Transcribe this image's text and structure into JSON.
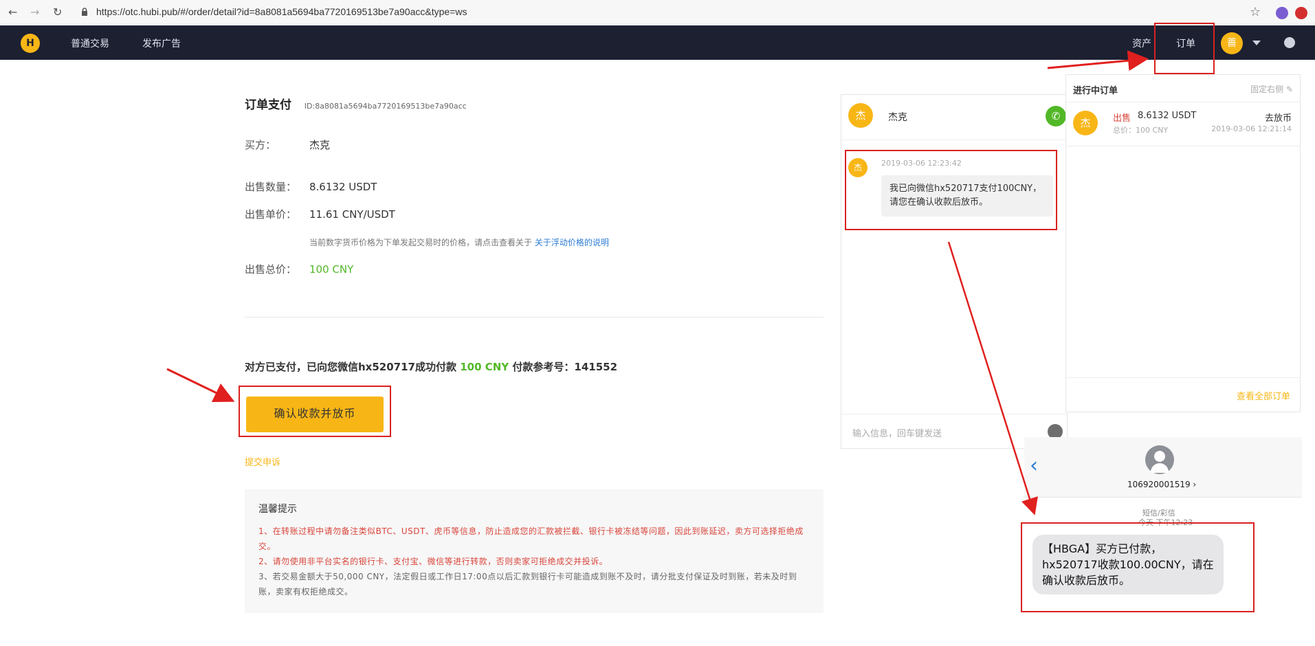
{
  "browser": {
    "url": "https://otc.hubi.pub/#/order/detail?id=8a8081a5694ba7720169513be7a90acc&type=ws"
  },
  "topnav": {
    "logo_text": "H",
    "items": [
      "普通交易",
      "发布广告"
    ],
    "assets": "资产",
    "orders": "订单",
    "avatar": "蔷"
  },
  "order": {
    "title": "订单支付",
    "id": "ID:8a8081a5694ba7720169513be7a90acc",
    "buyer_label": "买方：",
    "buyer": "杰克",
    "qty_label": "出售数量：",
    "qty": "8.6132 USDT",
    "price_label": "出售单价：",
    "price": "11.61 CNY/USDT",
    "price_note": "当前数字货币价格为下单发起交易时的价格，请点击查看关于",
    "price_note_link": "关于浮动价格的说明",
    "total_label": "出售总价：",
    "total": "100 CNY",
    "paid_prefix": "对方已支付，已向您微信hx520717成功付款",
    "paid_amount": "100 CNY",
    "paid_suffix": "付款参考号：141552",
    "confirm_button": "确认收款并放币",
    "appeal": "提交申诉"
  },
  "tips": {
    "title": "温馨提示",
    "lines": [
      "1、在转账过程中请勿备注类似BTC、USDT、虎币等信息，防止造成您的汇款被拦截、银行卡被冻结等问题，因此到账延迟，卖方可选择拒绝成交。",
      "2、请勿使用非平台实名的银行卡、支付宝、微信等进行转款，否则卖家可拒绝成交并投诉。",
      "3、若交易金额大于50,000 CNY，法定假日或工作日17:00点以后汇款到银行卡可能造成到账不及时，请分批支付保证及时到账，若未及时到账，卖家有权拒绝成交。"
    ]
  },
  "chat": {
    "avatar": "杰",
    "name": "杰克",
    "msg_time": "2019-03-06 12:23:42",
    "msg_avatar": "杰",
    "message": "我已向微信hx520717支付100CNY，请您在确认收款后放币。",
    "input_placeholder": "输入信息，回车键发送"
  },
  "orders_panel": {
    "title": "进行中订单",
    "pin": "固定右侧",
    "item": {
      "avatar": "杰",
      "side": "出售",
      "amount": "8.6132 USDT",
      "action": "去放币",
      "total": "总价：100 CNY",
      "time": "2019-03-06 12:21:14"
    },
    "view_all": "查看全部订单"
  },
  "sms": {
    "sender": "106920001519 ›",
    "type": "短信/彩信",
    "day": "今天 下午12:23",
    "message": "【HBGA】买方已付款，hx520717收款100.00CNY，请在确认收款后放币。"
  }
}
